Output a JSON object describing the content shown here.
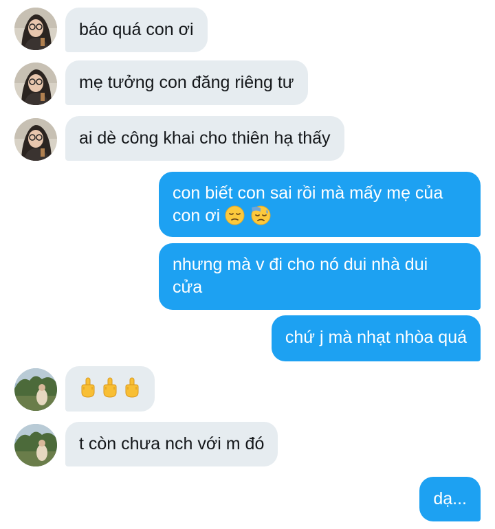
{
  "messages": [
    {
      "side": "in",
      "sender": "girl",
      "text": "báo quá con ơi"
    },
    {
      "side": "in",
      "sender": "girl",
      "text": "mẹ tưởng con đăng riêng tư"
    },
    {
      "side": "in",
      "sender": "girl",
      "text": "ai dè công khai cho thiên hạ thấy"
    },
    {
      "side": "out",
      "text_line1": "con biết con sai rồi mà mấy mẹ của",
      "text_line2": "con ơi",
      "emojis": [
        "pensive-face",
        "sad-sweat-face"
      ]
    },
    {
      "side": "out",
      "text_line1": "nhưng mà v đi cho nó dui nhà dui",
      "text_line2": "cửa"
    },
    {
      "side": "out",
      "text": "chứ j mà nhạt nhòa quá"
    },
    {
      "side": "in",
      "sender": "park",
      "emojis": [
        "middle-finger",
        "middle-finger",
        "middle-finger"
      ]
    },
    {
      "side": "in",
      "sender": "park",
      "text": "t còn chưa nch với m đó"
    },
    {
      "side": "out",
      "text": "dạ..."
    }
  ],
  "colors": {
    "incoming_bubble": "#e6ecf0",
    "outgoing_bubble": "#1da1f2",
    "incoming_text": "#14171a",
    "outgoing_text": "#ffffff"
  }
}
